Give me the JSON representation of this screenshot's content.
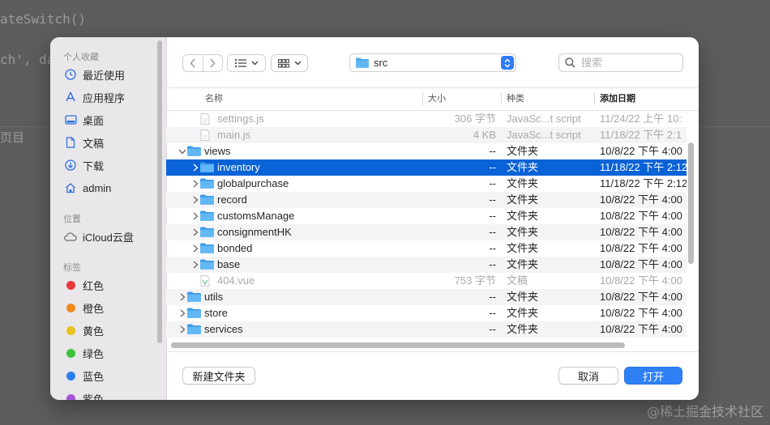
{
  "background": {
    "code_line_1": "ateSwitch()",
    "code_line_2": "ch', da",
    "code_line_3": "页目",
    "watermark": "@稀土掘金技术社区"
  },
  "sidebar": {
    "favorites_title": "个人收藏",
    "favorites": [
      {
        "label": "最近使用",
        "icon": "clock-icon"
      },
      {
        "label": "应用程序",
        "icon": "applications-icon"
      },
      {
        "label": "桌面",
        "icon": "desktop-icon"
      },
      {
        "label": "文稿",
        "icon": "document-icon"
      },
      {
        "label": "下载",
        "icon": "download-icon"
      },
      {
        "label": "admin",
        "icon": "home-icon"
      }
    ],
    "locations_title": "位置",
    "locations": [
      {
        "label": "iCloud云盘",
        "icon": "cloud-icon"
      }
    ],
    "tags_title": "标签",
    "tags": [
      {
        "label": "红色",
        "color": "#e8383b"
      },
      {
        "label": "橙色",
        "color": "#f08a1d"
      },
      {
        "label": "黄色",
        "color": "#e8c21f"
      },
      {
        "label": "绿色",
        "color": "#3bc43b"
      },
      {
        "label": "蓝色",
        "color": "#2a7ff0"
      },
      {
        "label": "紫色",
        "color": "#a554d8"
      }
    ]
  },
  "toolbar": {
    "back_icon": "chevron-left-icon",
    "forward_icon": "chevron-right-icon",
    "list_view_icon": "list-view-icon",
    "grid_view_icon": "grid-view-icon",
    "current_folder": "src",
    "search_placeholder": "搜索"
  },
  "columns": {
    "name": "名称",
    "size": "大小",
    "kind": "种类",
    "date_added": "添加日期"
  },
  "files": [
    {
      "name": "settings.js",
      "size": "306 字节",
      "kind": "JavaSc...t script",
      "date": "11/24/22 上午 10:",
      "level": 1,
      "type": "file",
      "expandable": false,
      "dim": true
    },
    {
      "name": "main.js",
      "size": "4 KB",
      "kind": "JavaSc...t script",
      "date": "11/18/22 下午 2:1",
      "level": 1,
      "type": "file",
      "expandable": false,
      "dim": true
    },
    {
      "name": "views",
      "size": "--",
      "kind": "文件夹",
      "date": "10/8/22 下午 4:00",
      "level": 0,
      "type": "folder",
      "expandable": true,
      "expanded": true
    },
    {
      "name": "inventory",
      "size": "--",
      "kind": "文件夹",
      "date": "11/18/22 下午 2:12",
      "level": 1,
      "type": "folder",
      "expandable": true,
      "selected": true
    },
    {
      "name": "globalpurchase",
      "size": "--",
      "kind": "文件夹",
      "date": "11/18/22 下午 2:12",
      "level": 1,
      "type": "folder",
      "expandable": true
    },
    {
      "name": "record",
      "size": "--",
      "kind": "文件夹",
      "date": "10/8/22 下午 4:00",
      "level": 1,
      "type": "folder",
      "expandable": true
    },
    {
      "name": "customsManage",
      "size": "--",
      "kind": "文件夹",
      "date": "10/8/22 下午 4:00",
      "level": 1,
      "type": "folder",
      "expandable": true
    },
    {
      "name": "consignmentHK",
      "size": "--",
      "kind": "文件夹",
      "date": "10/8/22 下午 4:00",
      "level": 1,
      "type": "folder",
      "expandable": true
    },
    {
      "name": "bonded",
      "size": "--",
      "kind": "文件夹",
      "date": "10/8/22 下午 4:00",
      "level": 1,
      "type": "folder",
      "expandable": true
    },
    {
      "name": "base",
      "size": "--",
      "kind": "文件夹",
      "date": "10/8/22 下午 4:00",
      "level": 1,
      "type": "folder",
      "expandable": true
    },
    {
      "name": "404.vue",
      "size": "753 字节",
      "kind": "文稿",
      "date": "10/8/22 下午 4:00",
      "level": 1,
      "type": "vue",
      "expandable": false,
      "dim": true
    },
    {
      "name": "utils",
      "size": "--",
      "kind": "文件夹",
      "date": "10/8/22 下午 4:00",
      "level": 0,
      "type": "folder",
      "expandable": true
    },
    {
      "name": "store",
      "size": "--",
      "kind": "文件夹",
      "date": "10/8/22 下午 4:00",
      "level": 0,
      "type": "folder",
      "expandable": true
    },
    {
      "name": "services",
      "size": "--",
      "kind": "文件夹",
      "date": "10/8/22 下午 4:00",
      "level": 0,
      "type": "folder",
      "expandable": true
    }
  ],
  "footer": {
    "new_folder": "新建文件夹",
    "cancel": "取消",
    "open": "打开"
  },
  "colors": {
    "accent": "#2f80f5",
    "selection": "#0a63d6",
    "folder": "#4aa8ee"
  }
}
